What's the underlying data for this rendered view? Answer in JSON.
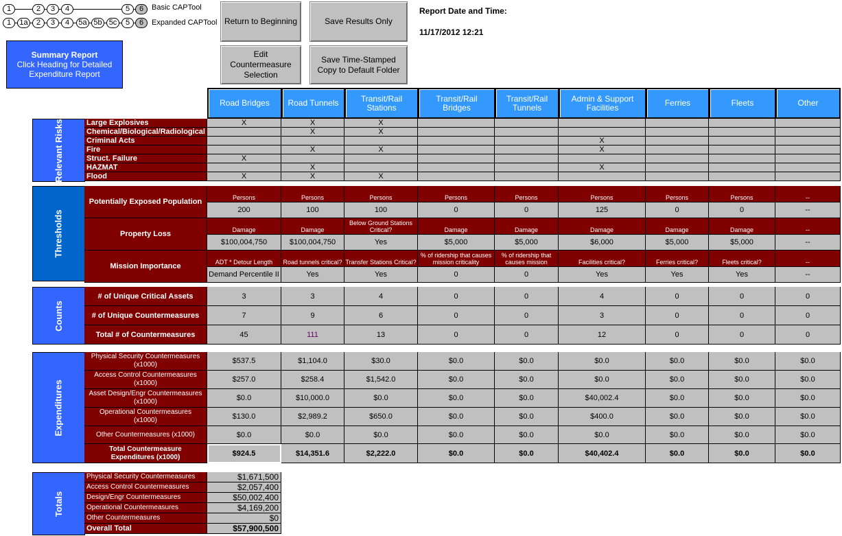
{
  "nav": {
    "basic_label": "Basic CAPTool",
    "expanded_label": "Expanded  CAPTool",
    "basic_steps": [
      "1",
      "2",
      "3",
      "4",
      "5",
      "6"
    ],
    "expanded_steps": [
      "1",
      "1a",
      "2",
      "3",
      "4",
      "5a",
      "5b",
      "5c",
      "5",
      "6"
    ]
  },
  "summary_box": {
    "title": "Summary Report",
    "line1": "Click Heading for Detailed",
    "line2": "Expenditure Report"
  },
  "buttons": {
    "return": "Return to Beginning",
    "save_results": "Save Results Only",
    "edit": "Edit Countermeasure Selection",
    "save_stamped": "Save Time-Stamped Copy to Default Folder"
  },
  "report": {
    "label": "Report Date and Time:",
    "datetime": "11/17/2012 12:21"
  },
  "columns": [
    "Road Bridges",
    "Road Tunnels",
    "Transit/Rail Stations",
    "Transit/Rail Bridges",
    "Transit/Rail Tunnels",
    "Admin & Support Facilities",
    "Ferries",
    "Fleets",
    "Other"
  ],
  "sections": {
    "risks": "Relevant Risks",
    "thresholds": "Thresholds",
    "counts": "Counts",
    "expenditures": "Expenditures",
    "totals": "Totals"
  },
  "risks": [
    {
      "label": "Large Explosives",
      "marks": [
        "X",
        "X",
        "X",
        "",
        "",
        "",
        "",
        "",
        ""
      ]
    },
    {
      "label": "Chemical/Biological/Radiological",
      "marks": [
        "",
        "X",
        "X",
        "",
        "",
        "",
        "",
        "",
        ""
      ]
    },
    {
      "label": "Criminal Acts",
      "marks": [
        "",
        "",
        "",
        "",
        "",
        "X",
        "",
        "",
        ""
      ]
    },
    {
      "label": "Fire",
      "marks": [
        "",
        "X",
        "X",
        "",
        "",
        "X",
        "",
        "",
        ""
      ]
    },
    {
      "label": "Struct. Failure",
      "marks": [
        "X",
        "",
        "",
        "",
        "",
        "",
        "",
        "",
        ""
      ]
    },
    {
      "label": "HAZMAT",
      "marks": [
        "",
        "X",
        "",
        "",
        "",
        "X",
        "",
        "",
        ""
      ]
    },
    {
      "label": "Flood",
      "marks": [
        "X",
        "X",
        "X",
        "",
        "",
        "",
        "",
        "",
        ""
      ]
    }
  ],
  "thresholds": [
    {
      "label": "Potentially Exposed Population",
      "headers": [
        "Persons",
        "Persons",
        "Persons",
        "Persons",
        "Persons",
        "Persons",
        "Persons",
        "Persons",
        "--"
      ],
      "values": [
        "200",
        "100",
        "100",
        "0",
        "0",
        "125",
        "0",
        "0",
        "--"
      ]
    },
    {
      "label": "Property Loss",
      "headers": [
        "Damage",
        "Damage",
        "Below Ground Stations Critical?",
        "Damage",
        "Damage",
        "Damage",
        "Damage",
        "Damage",
        "--"
      ],
      "values": [
        "$100,004,750",
        "$100,004,750",
        "Yes",
        "$5,000",
        "$5,000",
        "$6,000",
        "$5,000",
        "$5,000",
        "--"
      ]
    },
    {
      "label": "Mission Importance",
      "headers": [
        "ADT * Detour Length",
        "Road tunnels critical?",
        "Transfer Stations Critical?",
        "% of ridership that causes mission criticality",
        "% of ridership that causes mission",
        "Facilities critical?",
        "Ferries critical?",
        "Fleets critical?",
        "--"
      ],
      "values": [
        "Demand Percentile II",
        "Yes",
        "Yes",
        "0",
        "0",
        "Yes",
        "Yes",
        "Yes",
        "--"
      ]
    }
  ],
  "counts": [
    {
      "label": "# of Unique Critical Assets",
      "values": [
        "3",
        "3",
        "4",
        "0",
        "0",
        "4",
        "0",
        "0",
        "0"
      ]
    },
    {
      "label": "# of Unique Countermeasures",
      "values": [
        "7",
        "9",
        "6",
        "0",
        "0",
        "3",
        "0",
        "0",
        "0"
      ]
    },
    {
      "label": "Total # of Countermeasures",
      "values": [
        "45",
        "111",
        "13",
        "0",
        "0",
        "12",
        "0",
        "0",
        "0"
      ]
    }
  ],
  "expenditures": [
    {
      "label": "Physical Security Countermeasures (x1000)",
      "values": [
        "$537.5",
        "$1,104.0",
        "$30.0",
        "$0.0",
        "$0.0",
        "$0.0",
        "$0.0",
        "$0.0",
        "$0.0"
      ]
    },
    {
      "label": "Access Control Countermeasures (x1000)",
      "values": [
        "$257.0",
        "$258.4",
        "$1,542.0",
        "$0.0",
        "$0.0",
        "$0.0",
        "$0.0",
        "$0.0",
        "$0.0"
      ]
    },
    {
      "label": "Asset Design/Engr Countermeasures (x1000)",
      "values": [
        "$0.0",
        "$10,000.0",
        "$0.0",
        "$0.0",
        "$0.0",
        "$40,002.4",
        "$0.0",
        "$0.0",
        "$0.0"
      ]
    },
    {
      "label": "Operational Countermeasures (x1000)",
      "values": [
        "$130.0",
        "$2,989.2",
        "$650.0",
        "$0.0",
        "$0.0",
        "$400.0",
        "$0.0",
        "$0.0",
        "$0.0"
      ]
    },
    {
      "label": "Other Countermeasures (x1000)",
      "values": [
        "$0.0",
        "$0.0",
        "$0.0",
        "$0.0",
        "$0.0",
        "$0.0",
        "$0.0",
        "$0.0",
        "$0.0"
      ]
    },
    {
      "label": "Total Countermeasure Expenditures (x1000)",
      "values": [
        "$924.5",
        "$14,351.6",
        "$2,222.0",
        "$0.0",
        "$0.0",
        "$40,402.4",
        "$0.0",
        "$0.0",
        "$0.0"
      ]
    }
  ],
  "totals": [
    {
      "label": "Physical Security Countermeasures",
      "value": "$1,671,500"
    },
    {
      "label": "Access Control Countermeasures",
      "value": "$2,057,400"
    },
    {
      "label": "Design/Engr Countermeasures",
      "value": "$50,002,400"
    },
    {
      "label": "Operational Countermeasures",
      "value": "$4,169,200"
    },
    {
      "label": "Other Countermeasures",
      "value": "$0"
    },
    {
      "label": "Overall Total",
      "value": "$57,900,500"
    }
  ],
  "colors": {
    "accent_blue": "#3399ff",
    "header_red": "#800000",
    "cell_gray": "#c0c0c0",
    "count_highlight": "#660066"
  }
}
